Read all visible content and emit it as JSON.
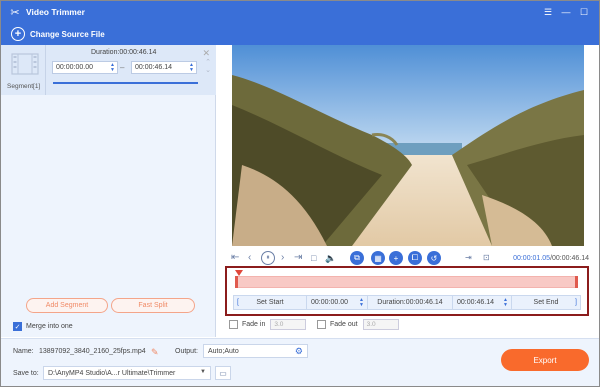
{
  "window": {
    "title": "Video Trimmer"
  },
  "toolbar": {
    "change_source_label": "Change Source File"
  },
  "segment": {
    "duration_label": "Duration:00:00:46.14",
    "start_time": "00:00:00.00",
    "end_time": "00:00:46.14",
    "label": "Segment[1]"
  },
  "left_actions": {
    "add_segment_label": "Add Segment",
    "fast_split_label": "Fast Split",
    "merge_label": "Merge into one",
    "merge_checked": true
  },
  "player": {
    "time_current": "00:00:01.05",
    "time_total": "/00:00:46.14"
  },
  "trim": {
    "set_start_label": "Set Start",
    "start_value": "00:00:00.00",
    "duration_label": "Duration:00:00:46.14",
    "end_value": "00:00:46.14",
    "set_end_label": "Set End"
  },
  "fades": {
    "fade_in_label": "Fade in",
    "fade_in_value": "3.0",
    "fade_out_label": "Fade out",
    "fade_out_value": "3.0"
  },
  "bottom": {
    "name_label": "Name:",
    "name_value": "13897092_3840_2160_25fps.mp4",
    "output_label": "Output:",
    "output_value": "Auto;Auto",
    "save_label": "Save to:",
    "save_value": "D:\\AnyMP4 Studio\\A...r Ultimate\\Trimmer",
    "export_label": "Export"
  },
  "colors": {
    "accent": "#3a6fd8",
    "export": "#f96a2c",
    "trim_highlight": "#8b1c1c"
  }
}
